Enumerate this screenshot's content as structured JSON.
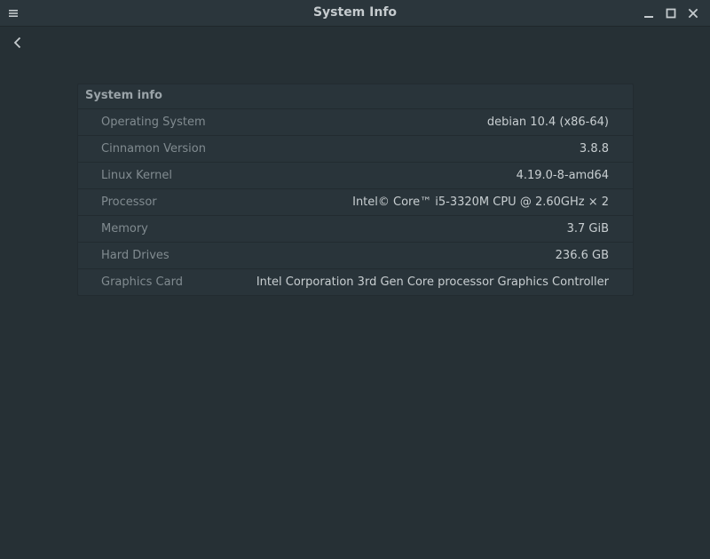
{
  "window": {
    "title": "System Info"
  },
  "panel": {
    "header": "System info",
    "rows": [
      {
        "label": "Operating System",
        "value": "debian 10.4 (x86-64)"
      },
      {
        "label": "Cinnamon Version",
        "value": "3.8.8"
      },
      {
        "label": "Linux Kernel",
        "value": "4.19.0-8-amd64"
      },
      {
        "label": "Processor",
        "value": "Intel© Core™ i5-3320M CPU @ 2.60GHz × 2"
      },
      {
        "label": "Memory",
        "value": "3.7 GiB"
      },
      {
        "label": "Hard Drives",
        "value": "236.6 GB"
      },
      {
        "label": "Graphics Card",
        "value": "Intel Corporation 3rd Gen Core processor Graphics Controller"
      }
    ]
  },
  "icons": {
    "menu": "hamburger-menu-icon",
    "back": "chevron-left-icon",
    "minimize": "minimize-icon",
    "maximize": "maximize-icon",
    "close": "close-icon"
  },
  "colors": {
    "background": "#263035",
    "panel": "#29343a",
    "text_primary": "#c8ced1",
    "text_secondary": "#818b90"
  }
}
